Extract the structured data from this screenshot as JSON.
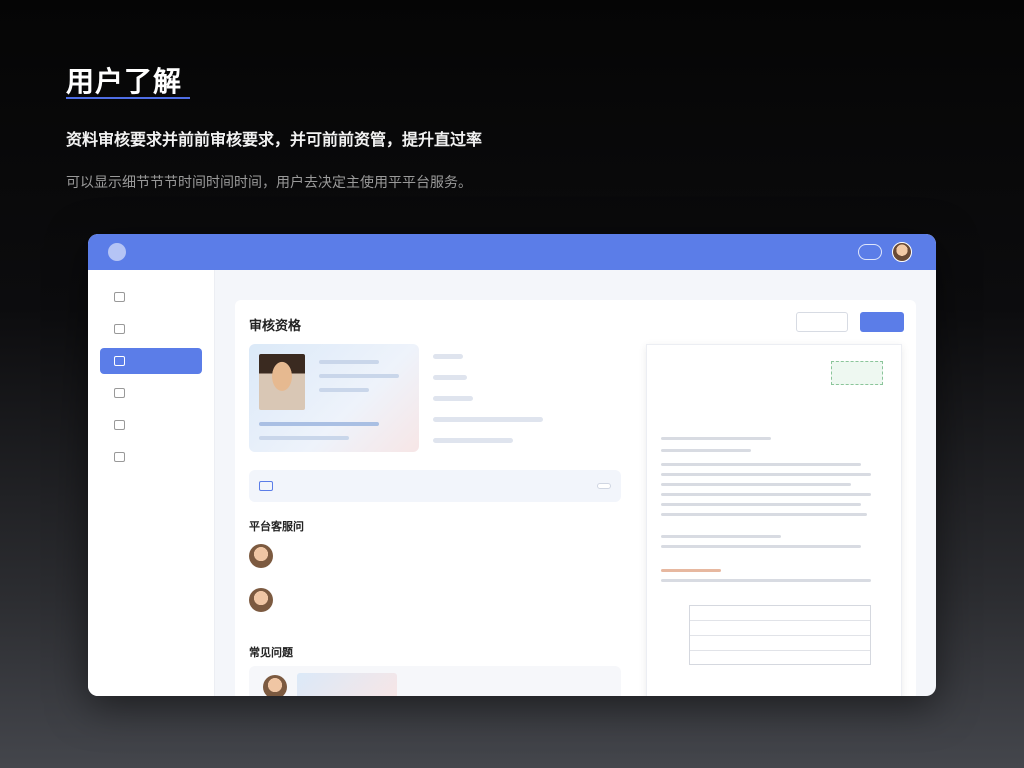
{
  "hero": {
    "title": "用户了解",
    "subtitle": "资料审核要求并前前审核要求，并可前前资管，提升直过率",
    "description": "可以显示细节节节时间时间时间，用户去决定主使用平平台服务。"
  },
  "app": {
    "brand": "",
    "top_nav": "",
    "user_name": "",
    "accent": "#5b7de8",
    "sidebar": [
      {
        "label": "",
        "icon": "home-icon",
        "active": false
      },
      {
        "label": "",
        "icon": "list-icon",
        "active": false
      },
      {
        "label": "",
        "icon": "doc-icon",
        "active": true
      },
      {
        "label": "",
        "icon": "chart-icon",
        "active": false
      },
      {
        "label": "",
        "icon": "user-icon",
        "active": false
      },
      {
        "label": "",
        "icon": "settings-icon",
        "active": false
      }
    ],
    "breadcrumb": "",
    "card": {
      "title": "审核资格",
      "tag": "",
      "btn_default": "",
      "btn_primary": "",
      "more_link": "",
      "tip_highlight": "",
      "tip_text": "",
      "tip_button": "",
      "section_reviews": "平台客服问",
      "reviews": [
        {
          "text": "",
          "meta": ""
        },
        {
          "text": "",
          "meta": ""
        }
      ],
      "section_faq": "常见问题",
      "faq_more": "",
      "faq_item": ""
    },
    "document": {
      "title": "",
      "stamp": "",
      "row1": "",
      "row2": "",
      "row3": "",
      "side_label": ""
    }
  }
}
